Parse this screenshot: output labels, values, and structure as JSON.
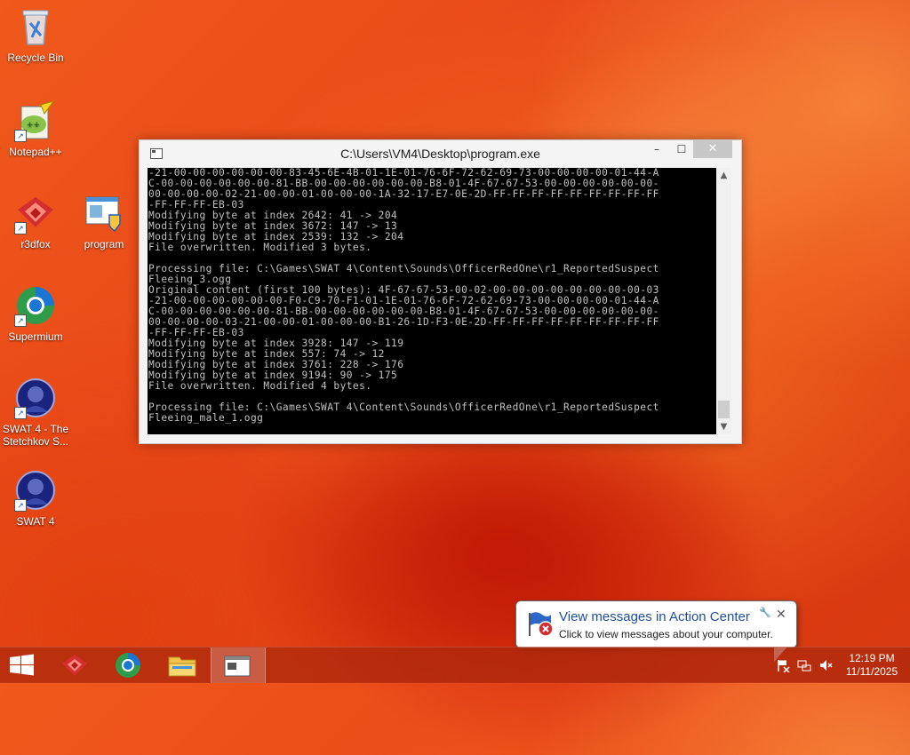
{
  "desktop": {
    "icons": [
      {
        "label": "Recycle Bin",
        "icon": "recycle-bin-icon"
      },
      {
        "label": "Notepad++",
        "icon": "notepad-plus-plus-icon"
      },
      {
        "label": "r3dfox",
        "icon": "r3dfox-icon"
      },
      {
        "label": "program",
        "icon": "program-icon"
      },
      {
        "label": "Supermium",
        "icon": "supermium-icon"
      },
      {
        "label": "SWAT 4 - The Stetchkov S...",
        "icon": "swat4-stetchkov-icon"
      },
      {
        "label": "SWAT 4",
        "icon": "swat4-icon"
      }
    ]
  },
  "window": {
    "title": "C:\\Users\\VM4\\Desktop\\program.exe",
    "minimize": "–",
    "maximize": "☐",
    "close": "✕",
    "console_text": "-21-00-00-00-00-00-00-83-45-6E-4B-01-1E-01-76-6F-72-62-69-73-00-00-00-00-01-44-A\nC-00-00-00-00-00-00-81-BB-00-00-00-00-00-00-B8-01-4F-67-67-53-00-00-00-00-00-00-\n00-00-00-00-02-21-00-00-01-00-00-00-1A-32-17-E7-0E-2D-FF-FF-FF-FF-FF-FF-FF-FF-FF\n-FF-FF-FF-EB-03\nModifying byte at index 2642: 41 -> 204\nModifying byte at index 3672: 147 -> 13\nModifying byte at index 2539: 132 -> 204\nFile overwritten. Modified 3 bytes.\n\nProcessing file: C:\\Games\\SWAT 4\\Content\\Sounds\\OfficerRedOne\\r1_ReportedSuspect\nFleeing_3.ogg\nOriginal content (first 100 bytes): 4F-67-67-53-00-02-00-00-00-00-00-00-00-00-03\n-21-00-00-00-00-00-00-F0-C9-70-F1-01-1E-01-76-6F-72-62-69-73-00-00-00-00-01-44-A\nC-00-00-00-00-00-00-81-BB-00-00-00-00-00-00-B8-01-4F-67-67-53-00-00-00-00-00-00-\n00-00-00-00-03-21-00-00-01-00-00-00-B1-26-1D-F3-0E-2D-FF-FF-FF-FF-FF-FF-FF-FF-FF\n-FF-FF-FF-EB-03\nModifying byte at index 3928: 147 -> 119\nModifying byte at index 557: 74 -> 12\nModifying byte at index 3761: 228 -> 176\nModifying byte at index 9194: 90 -> 175\nFile overwritten. Modified 4 bytes.\n\nProcessing file: C:\\Games\\SWAT 4\\Content\\Sounds\\OfficerRedOne\\r1_ReportedSuspect\nFleeing_male_1.ogg"
  },
  "notification": {
    "title": "View messages in Action Center",
    "text": "Click to view messages about your computer.",
    "close": "✕",
    "icon": "action-center-flag-icon"
  },
  "taskbar": {
    "start_icon": "windows-start-icon",
    "pinned": [
      {
        "name": "r3dfox",
        "icon": "r3dfox-icon"
      },
      {
        "name": "Supermium",
        "icon": "supermium-icon"
      },
      {
        "name": "File Explorer",
        "icon": "file-explorer-icon"
      },
      {
        "name": "program.exe",
        "icon": "console-program-icon",
        "active": true
      }
    ],
    "clock": {
      "time": "12:19 PM",
      "date": "11/11/2025"
    }
  },
  "colors": {
    "wallpaper": "#e8461a",
    "console_bg": "#000000",
    "console_text": "#c0c0c0",
    "close_button": "#c7c7c7",
    "balloon_title": "#1f4e9e"
  }
}
